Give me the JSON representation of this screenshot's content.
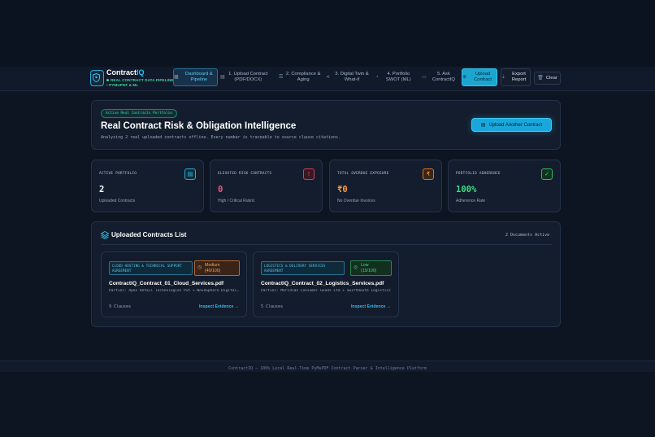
{
  "brand": {
    "name_prefix": "Contract",
    "name_accent": "IQ",
    "tagline": "REAL CONTRACT DATA PIPELINE • PYMUPDF & ML"
  },
  "nav": {
    "items": [
      {
        "label": "Dashboard & Pipeline",
        "icon": "grid-icon",
        "active": true
      },
      {
        "label": "1. Upload Contract (PDF/DOCX)",
        "icon": "file-icon"
      },
      {
        "label": "2. Compliance & Aging",
        "icon": "list-icon"
      },
      {
        "label": "3. Digital Twin & What-if",
        "icon": "share-icon"
      },
      {
        "label": "4. Portfolio SWOT (ML)",
        "icon": "pie-icon"
      },
      {
        "label": "5. Ask ContractIQ",
        "icon": "chat-icon"
      }
    ],
    "upload_button": "Upload Contract",
    "export_button": "Export Report",
    "clear_button": "Clear"
  },
  "hero": {
    "pill": "Active Real Contracts Portfolio",
    "title": "Real Contract Risk & Obligation Intelligence",
    "subtitle": "Analyzing 2 real uploaded contracts offline. Every number is traceable to source clause citations.",
    "upload_button": "Upload Another Contract"
  },
  "stats": [
    {
      "label": "ACTIVE PORTFOLIO",
      "value": "2",
      "foot": "Uploaded Contracts",
      "icon": "document-icon",
      "color": "#ffffff",
      "accent": "#2aa9d8"
    },
    {
      "label": "ELEVATED RISK CONTRACTS",
      "value": "0",
      "foot": "High / Critical Rubric",
      "icon": "alert-icon",
      "color": "#f0567a",
      "accent": "#e0445e"
    },
    {
      "label": "TOTAL OVERDUE EXPOSURE",
      "value": "₹0",
      "foot": "No Overdue Invoices",
      "icon": "rupee-icon",
      "color": "#f59e42",
      "accent": "#e07a2a"
    },
    {
      "label": "PORTFOLIO ADHERENCE",
      "value": "100%",
      "foot": "Adherence Rate",
      "icon": "check-circle-icon",
      "color": "#3ddc84",
      "accent": "#2fb866"
    }
  ],
  "contracts_list": {
    "title": "Uploaded Contracts List",
    "count_label": "2 Documents Active",
    "items": [
      {
        "category": "CLOUD HOSTING & TECHNICAL SUPPORT AGREEMENT",
        "risk_level": "Medium",
        "risk_score": "(40/100)",
        "name": "ContractIQ_Contract_01_Cloud_Services.pdf",
        "parties": "Parties: Apex Retail Technologies Pvt + NovaSphere Digital Solutions",
        "clauses": "9 Clauses",
        "link": "Inspect Evidence →"
      },
      {
        "category": "LOGISTICS & DELIVERY SERVICES AGREEMENT",
        "risk_level": "Low",
        "risk_score": "(15/100)",
        "name": "ContractIQ_Contract_02_Logistics_Services.pdf",
        "parties": "Parties: Meridian Consumer Goods Ltd + SwiftRoute Logistics",
        "clauses": "5 Clauses",
        "link": "Inspect Evidence →"
      }
    ]
  },
  "footer": {
    "text": "ContractIQ — 100% Local Real-Time PyMuPDF Contract Parser & Intelligence Platform"
  }
}
